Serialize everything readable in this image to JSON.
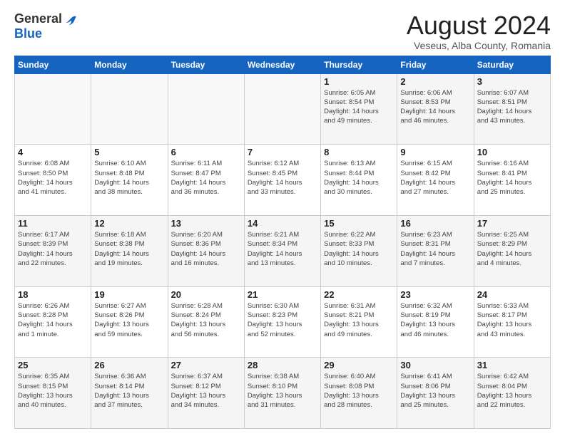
{
  "header": {
    "logo_general": "General",
    "logo_blue": "Blue",
    "month_title": "August 2024",
    "location": "Veseus, Alba County, Romania"
  },
  "days_of_week": [
    "Sunday",
    "Monday",
    "Tuesday",
    "Wednesday",
    "Thursday",
    "Friday",
    "Saturday"
  ],
  "weeks": [
    [
      {
        "day": "",
        "info": ""
      },
      {
        "day": "",
        "info": ""
      },
      {
        "day": "",
        "info": ""
      },
      {
        "day": "",
        "info": ""
      },
      {
        "day": "1",
        "info": "Sunrise: 6:05 AM\nSunset: 8:54 PM\nDaylight: 14 hours\nand 49 minutes."
      },
      {
        "day": "2",
        "info": "Sunrise: 6:06 AM\nSunset: 8:53 PM\nDaylight: 14 hours\nand 46 minutes."
      },
      {
        "day": "3",
        "info": "Sunrise: 6:07 AM\nSunset: 8:51 PM\nDaylight: 14 hours\nand 43 minutes."
      }
    ],
    [
      {
        "day": "4",
        "info": "Sunrise: 6:08 AM\nSunset: 8:50 PM\nDaylight: 14 hours\nand 41 minutes."
      },
      {
        "day": "5",
        "info": "Sunrise: 6:10 AM\nSunset: 8:48 PM\nDaylight: 14 hours\nand 38 minutes."
      },
      {
        "day": "6",
        "info": "Sunrise: 6:11 AM\nSunset: 8:47 PM\nDaylight: 14 hours\nand 36 minutes."
      },
      {
        "day": "7",
        "info": "Sunrise: 6:12 AM\nSunset: 8:45 PM\nDaylight: 14 hours\nand 33 minutes."
      },
      {
        "day": "8",
        "info": "Sunrise: 6:13 AM\nSunset: 8:44 PM\nDaylight: 14 hours\nand 30 minutes."
      },
      {
        "day": "9",
        "info": "Sunrise: 6:15 AM\nSunset: 8:42 PM\nDaylight: 14 hours\nand 27 minutes."
      },
      {
        "day": "10",
        "info": "Sunrise: 6:16 AM\nSunset: 8:41 PM\nDaylight: 14 hours\nand 25 minutes."
      }
    ],
    [
      {
        "day": "11",
        "info": "Sunrise: 6:17 AM\nSunset: 8:39 PM\nDaylight: 14 hours\nand 22 minutes."
      },
      {
        "day": "12",
        "info": "Sunrise: 6:18 AM\nSunset: 8:38 PM\nDaylight: 14 hours\nand 19 minutes."
      },
      {
        "day": "13",
        "info": "Sunrise: 6:20 AM\nSunset: 8:36 PM\nDaylight: 14 hours\nand 16 minutes."
      },
      {
        "day": "14",
        "info": "Sunrise: 6:21 AM\nSunset: 8:34 PM\nDaylight: 14 hours\nand 13 minutes."
      },
      {
        "day": "15",
        "info": "Sunrise: 6:22 AM\nSunset: 8:33 PM\nDaylight: 14 hours\nand 10 minutes."
      },
      {
        "day": "16",
        "info": "Sunrise: 6:23 AM\nSunset: 8:31 PM\nDaylight: 14 hours\nand 7 minutes."
      },
      {
        "day": "17",
        "info": "Sunrise: 6:25 AM\nSunset: 8:29 PM\nDaylight: 14 hours\nand 4 minutes."
      }
    ],
    [
      {
        "day": "18",
        "info": "Sunrise: 6:26 AM\nSunset: 8:28 PM\nDaylight: 14 hours\nand 1 minute."
      },
      {
        "day": "19",
        "info": "Sunrise: 6:27 AM\nSunset: 8:26 PM\nDaylight: 13 hours\nand 59 minutes."
      },
      {
        "day": "20",
        "info": "Sunrise: 6:28 AM\nSunset: 8:24 PM\nDaylight: 13 hours\nand 56 minutes."
      },
      {
        "day": "21",
        "info": "Sunrise: 6:30 AM\nSunset: 8:23 PM\nDaylight: 13 hours\nand 52 minutes."
      },
      {
        "day": "22",
        "info": "Sunrise: 6:31 AM\nSunset: 8:21 PM\nDaylight: 13 hours\nand 49 minutes."
      },
      {
        "day": "23",
        "info": "Sunrise: 6:32 AM\nSunset: 8:19 PM\nDaylight: 13 hours\nand 46 minutes."
      },
      {
        "day": "24",
        "info": "Sunrise: 6:33 AM\nSunset: 8:17 PM\nDaylight: 13 hours\nand 43 minutes."
      }
    ],
    [
      {
        "day": "25",
        "info": "Sunrise: 6:35 AM\nSunset: 8:15 PM\nDaylight: 13 hours\nand 40 minutes."
      },
      {
        "day": "26",
        "info": "Sunrise: 6:36 AM\nSunset: 8:14 PM\nDaylight: 13 hours\nand 37 minutes."
      },
      {
        "day": "27",
        "info": "Sunrise: 6:37 AM\nSunset: 8:12 PM\nDaylight: 13 hours\nand 34 minutes."
      },
      {
        "day": "28",
        "info": "Sunrise: 6:38 AM\nSunset: 8:10 PM\nDaylight: 13 hours\nand 31 minutes."
      },
      {
        "day": "29",
        "info": "Sunrise: 6:40 AM\nSunset: 8:08 PM\nDaylight: 13 hours\nand 28 minutes."
      },
      {
        "day": "30",
        "info": "Sunrise: 6:41 AM\nSunset: 8:06 PM\nDaylight: 13 hours\nand 25 minutes."
      },
      {
        "day": "31",
        "info": "Sunrise: 6:42 AM\nSunset: 8:04 PM\nDaylight: 13 hours\nand 22 minutes."
      }
    ]
  ]
}
